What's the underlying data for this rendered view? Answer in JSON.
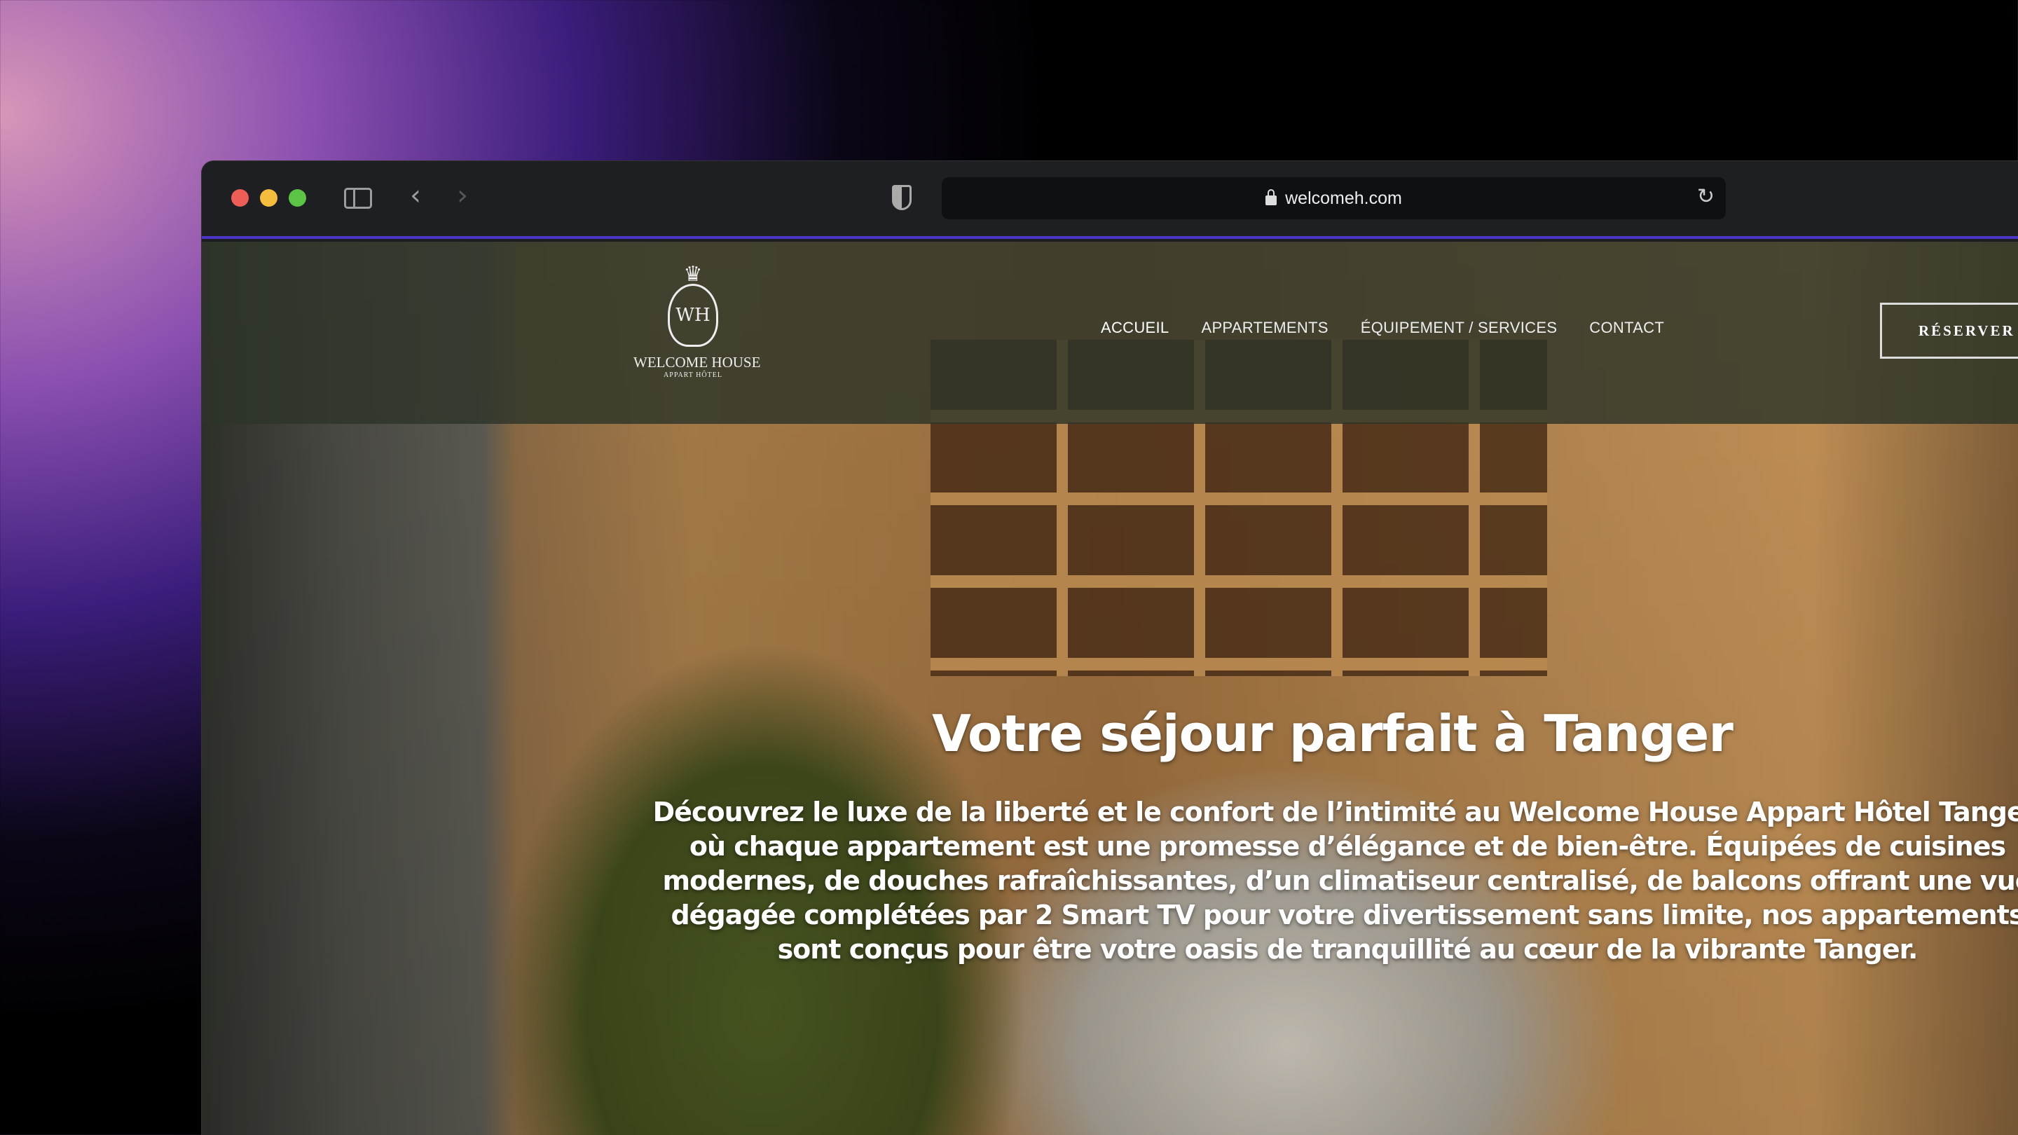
{
  "browser": {
    "url": "welcomeh.com",
    "icons": [
      "close-dot",
      "minimize-dot",
      "zoom-dot",
      "sidebar-icon",
      "back-icon",
      "forward-icon",
      "shield-icon",
      "lock-icon",
      "reload-icon"
    ],
    "back_glyph": "‹",
    "forward_glyph": "›",
    "reload_glyph": "↻"
  },
  "site": {
    "logo": {
      "monogram": "WH",
      "name": "WELCOME HOUSE",
      "subtitle": "APPART HÔTEL"
    },
    "nav": [
      {
        "label": "ACCUEIL"
      },
      {
        "label": "APPARTEMENTS"
      },
      {
        "label": "ÉQUIPEMENT / SERVICES"
      },
      {
        "label": "CONTACT"
      }
    ],
    "reserve_label": "RÉSERVER",
    "hero": {
      "title": "Votre séjour parfait à Tanger",
      "text": "Découvrez le luxe de la liberté et le confort de l’intimité au Welcome House Appart Hôtel Tanger, où chaque appartement est une promesse d’élégance et de bien-être. Équipées de cuisines modernes, de douches rafraîchissantes, d’un climatiseur centralisé, de balcons offrant une vue dégagée complétées par 2 Smart TV pour votre divertissement sans limite, nos appartements sont conçus pour être votre oasis de tranquillité au cœur de la vibrante Tanger."
    }
  }
}
